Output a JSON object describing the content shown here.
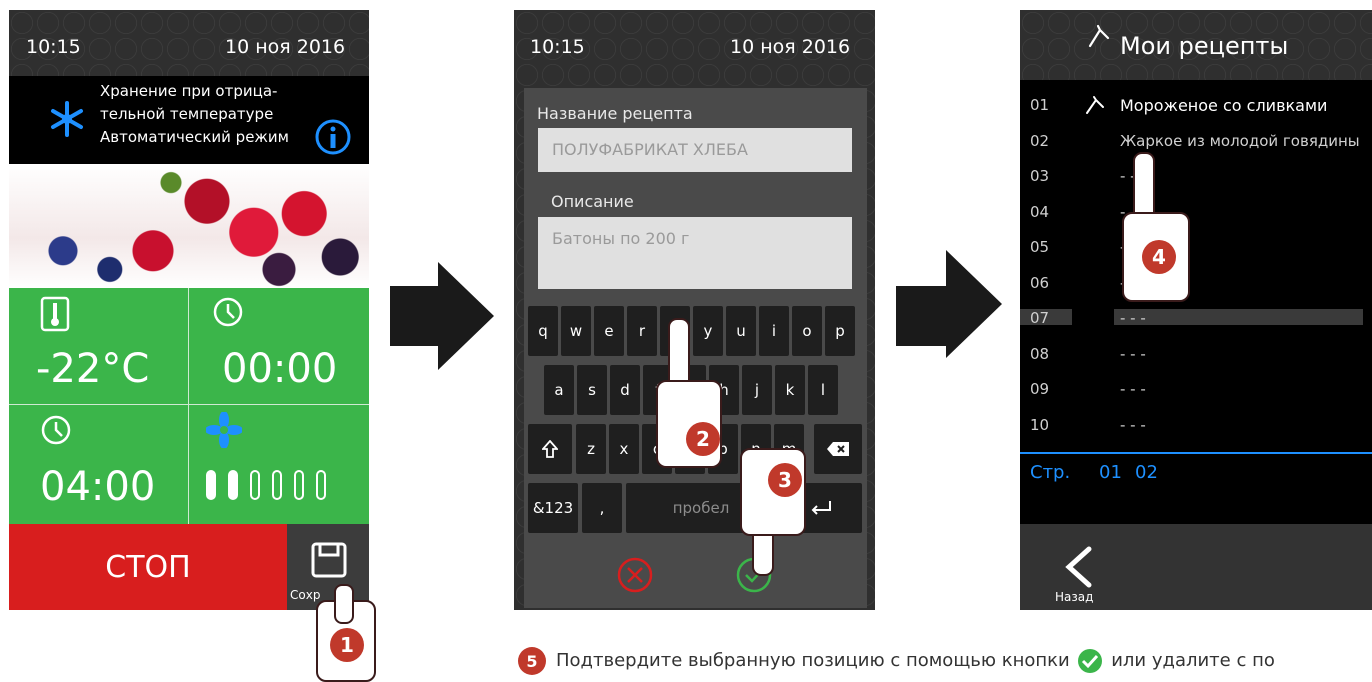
{
  "screen1": {
    "time": "10:15",
    "date": "10 ноя 2016",
    "mode_lines": [
      "Хранение при отрица-",
      "тельной температуре",
      "Автоматический режим"
    ],
    "temperature": "-22°C",
    "timer1": "00:00",
    "timer2": "04:00",
    "fan_level": 2,
    "fan_max": 6,
    "stop_label": "СТОП",
    "save_label": "Сохр",
    "step": "1"
  },
  "screen2": {
    "time": "10:15",
    "date": "10 ноя 2016",
    "recipe_name_label": "Название рецепта",
    "recipe_name_value": "ПОЛУФАБРИКАТ ХЛЕБА",
    "description_label": "Описание",
    "description_value": "Батоны по 200 г",
    "keyboard_row1": [
      "q",
      "w",
      "e",
      "r",
      "t",
      "y",
      "u",
      "i",
      "o",
      "p"
    ],
    "keyboard_row2": [
      "a",
      "s",
      "d",
      "f",
      "g",
      "h",
      "j",
      "k",
      "l"
    ],
    "keyboard_row3": [
      "z",
      "x",
      "c",
      "v",
      "b",
      "n",
      "m"
    ],
    "key_numbers": "&123",
    "key_comma": ",",
    "key_space": "пробел",
    "step_a": "2",
    "step_b": "3"
  },
  "screen3": {
    "title": "Мои рецепты",
    "rows": [
      {
        "num": "01",
        "name": "Мороженое со сливками"
      },
      {
        "num": "02",
        "name": "Жаркое из молодой говядины"
      },
      {
        "num": "03",
        "name": "- - -"
      },
      {
        "num": "04",
        "name": "- - -"
      },
      {
        "num": "05",
        "name": "- - -"
      },
      {
        "num": "06",
        "name": "- - -"
      },
      {
        "num": "07",
        "name": "- - -"
      },
      {
        "num": "08",
        "name": "- - -"
      },
      {
        "num": "09",
        "name": "- - -"
      },
      {
        "num": "10",
        "name": "- - -"
      }
    ],
    "page_label": "Стр.",
    "pages": [
      "01",
      "02"
    ],
    "back_label": "Назад",
    "step": "4"
  },
  "footer": {
    "step": "5",
    "text_before": "Подтвердите выбранную позицию с помощью кнопки",
    "text_after": "или удалите с по"
  },
  "colors": {
    "green": "#3bb54a",
    "red": "#d81e1e",
    "blue": "#1e90ff",
    "badge": "#c0392b"
  }
}
